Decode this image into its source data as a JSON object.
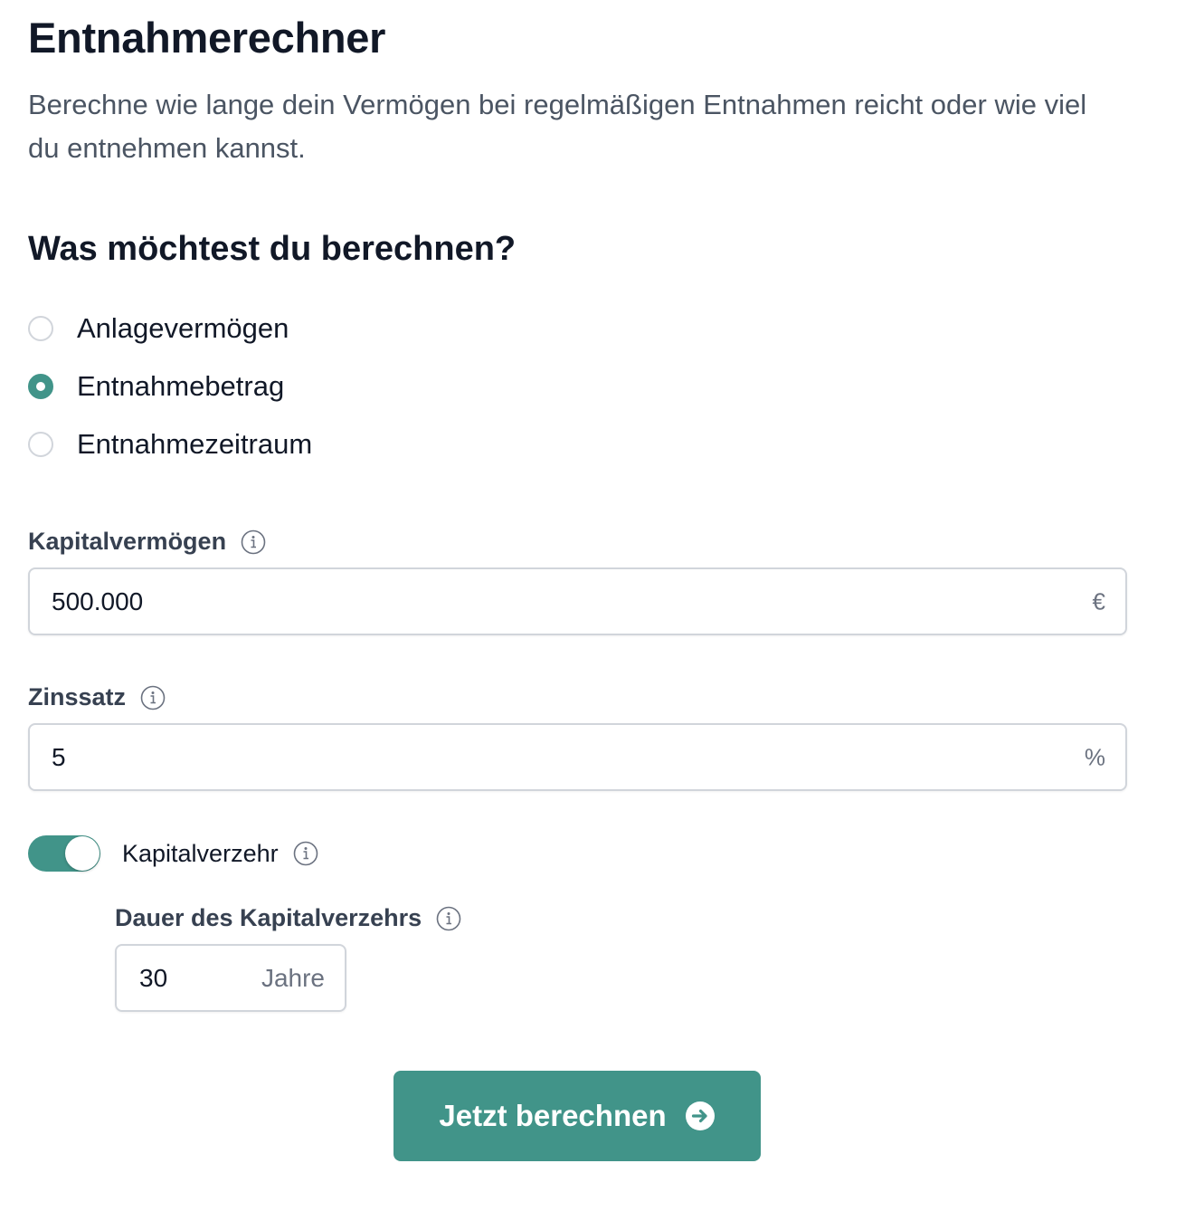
{
  "header": {
    "title": "Entnahmerechner",
    "intro": "Berechne wie lange dein Vermögen bei regelmäßigen Entnahmen reicht oder wie viel du entnehmen kannst."
  },
  "calculation_choice": {
    "question": "Was möchtest du berechnen?",
    "options": [
      {
        "label": "Anlagevermögen",
        "selected": false
      },
      {
        "label": "Entnahmebetrag",
        "selected": true
      },
      {
        "label": "Entnahmezeitraum",
        "selected": false
      }
    ]
  },
  "capital": {
    "label": "Kapitalvermögen",
    "value": "500.000",
    "unit": "€"
  },
  "interest": {
    "label": "Zinssatz",
    "value": "5",
    "unit": "%"
  },
  "capital_consumption": {
    "label": "Kapitalverzehr",
    "enabled": true
  },
  "duration": {
    "label": "Dauer des Kapitalverzehrs",
    "value": "30",
    "unit": "Jahre"
  },
  "submit": {
    "label": "Jetzt berechnen"
  },
  "colors": {
    "accent": "#419489",
    "heading": "#111827",
    "body_text": "#4b5563",
    "border": "#d1d5db"
  },
  "icons": {
    "info": "info-icon",
    "submit": "arrow-right-circle-icon"
  }
}
